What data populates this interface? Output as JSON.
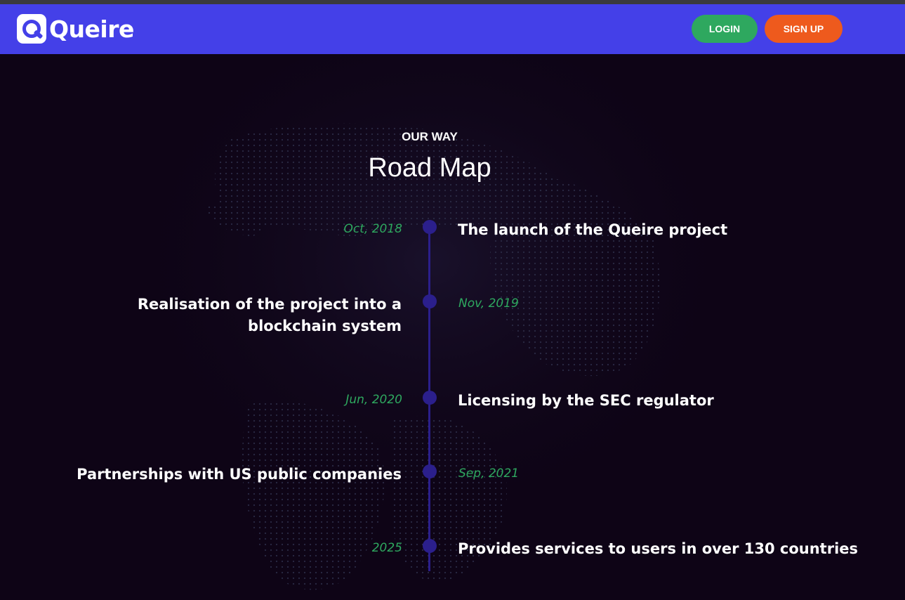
{
  "header": {
    "logo_text": "Queire",
    "login_label": "LOGIN",
    "signup_label": "SIGN UP"
  },
  "section": {
    "eyebrow": "OUR WAY",
    "title": "Road Map"
  },
  "roadmap": [
    {
      "date": "Oct, 2018",
      "text": "The launch of the Queire project"
    },
    {
      "date": "Nov, 2019",
      "text": "Realisation of the project into a blockchain system"
    },
    {
      "date": "Jun, 2020",
      "text": "Licensing by the SEC regulator"
    },
    {
      "date": "Sep, 2021",
      "text": "Partnerships with US public companies"
    },
    {
      "date": "2025",
      "text": "Provides services to users in over 130 countries"
    }
  ],
  "colors": {
    "header_bg": "#4440e8",
    "page_bg": "#0e0416",
    "login_btn": "#2ea85f",
    "signup_btn": "#ee5a1d",
    "timeline": "#2b1f8c",
    "date_text": "#2ea85f"
  }
}
